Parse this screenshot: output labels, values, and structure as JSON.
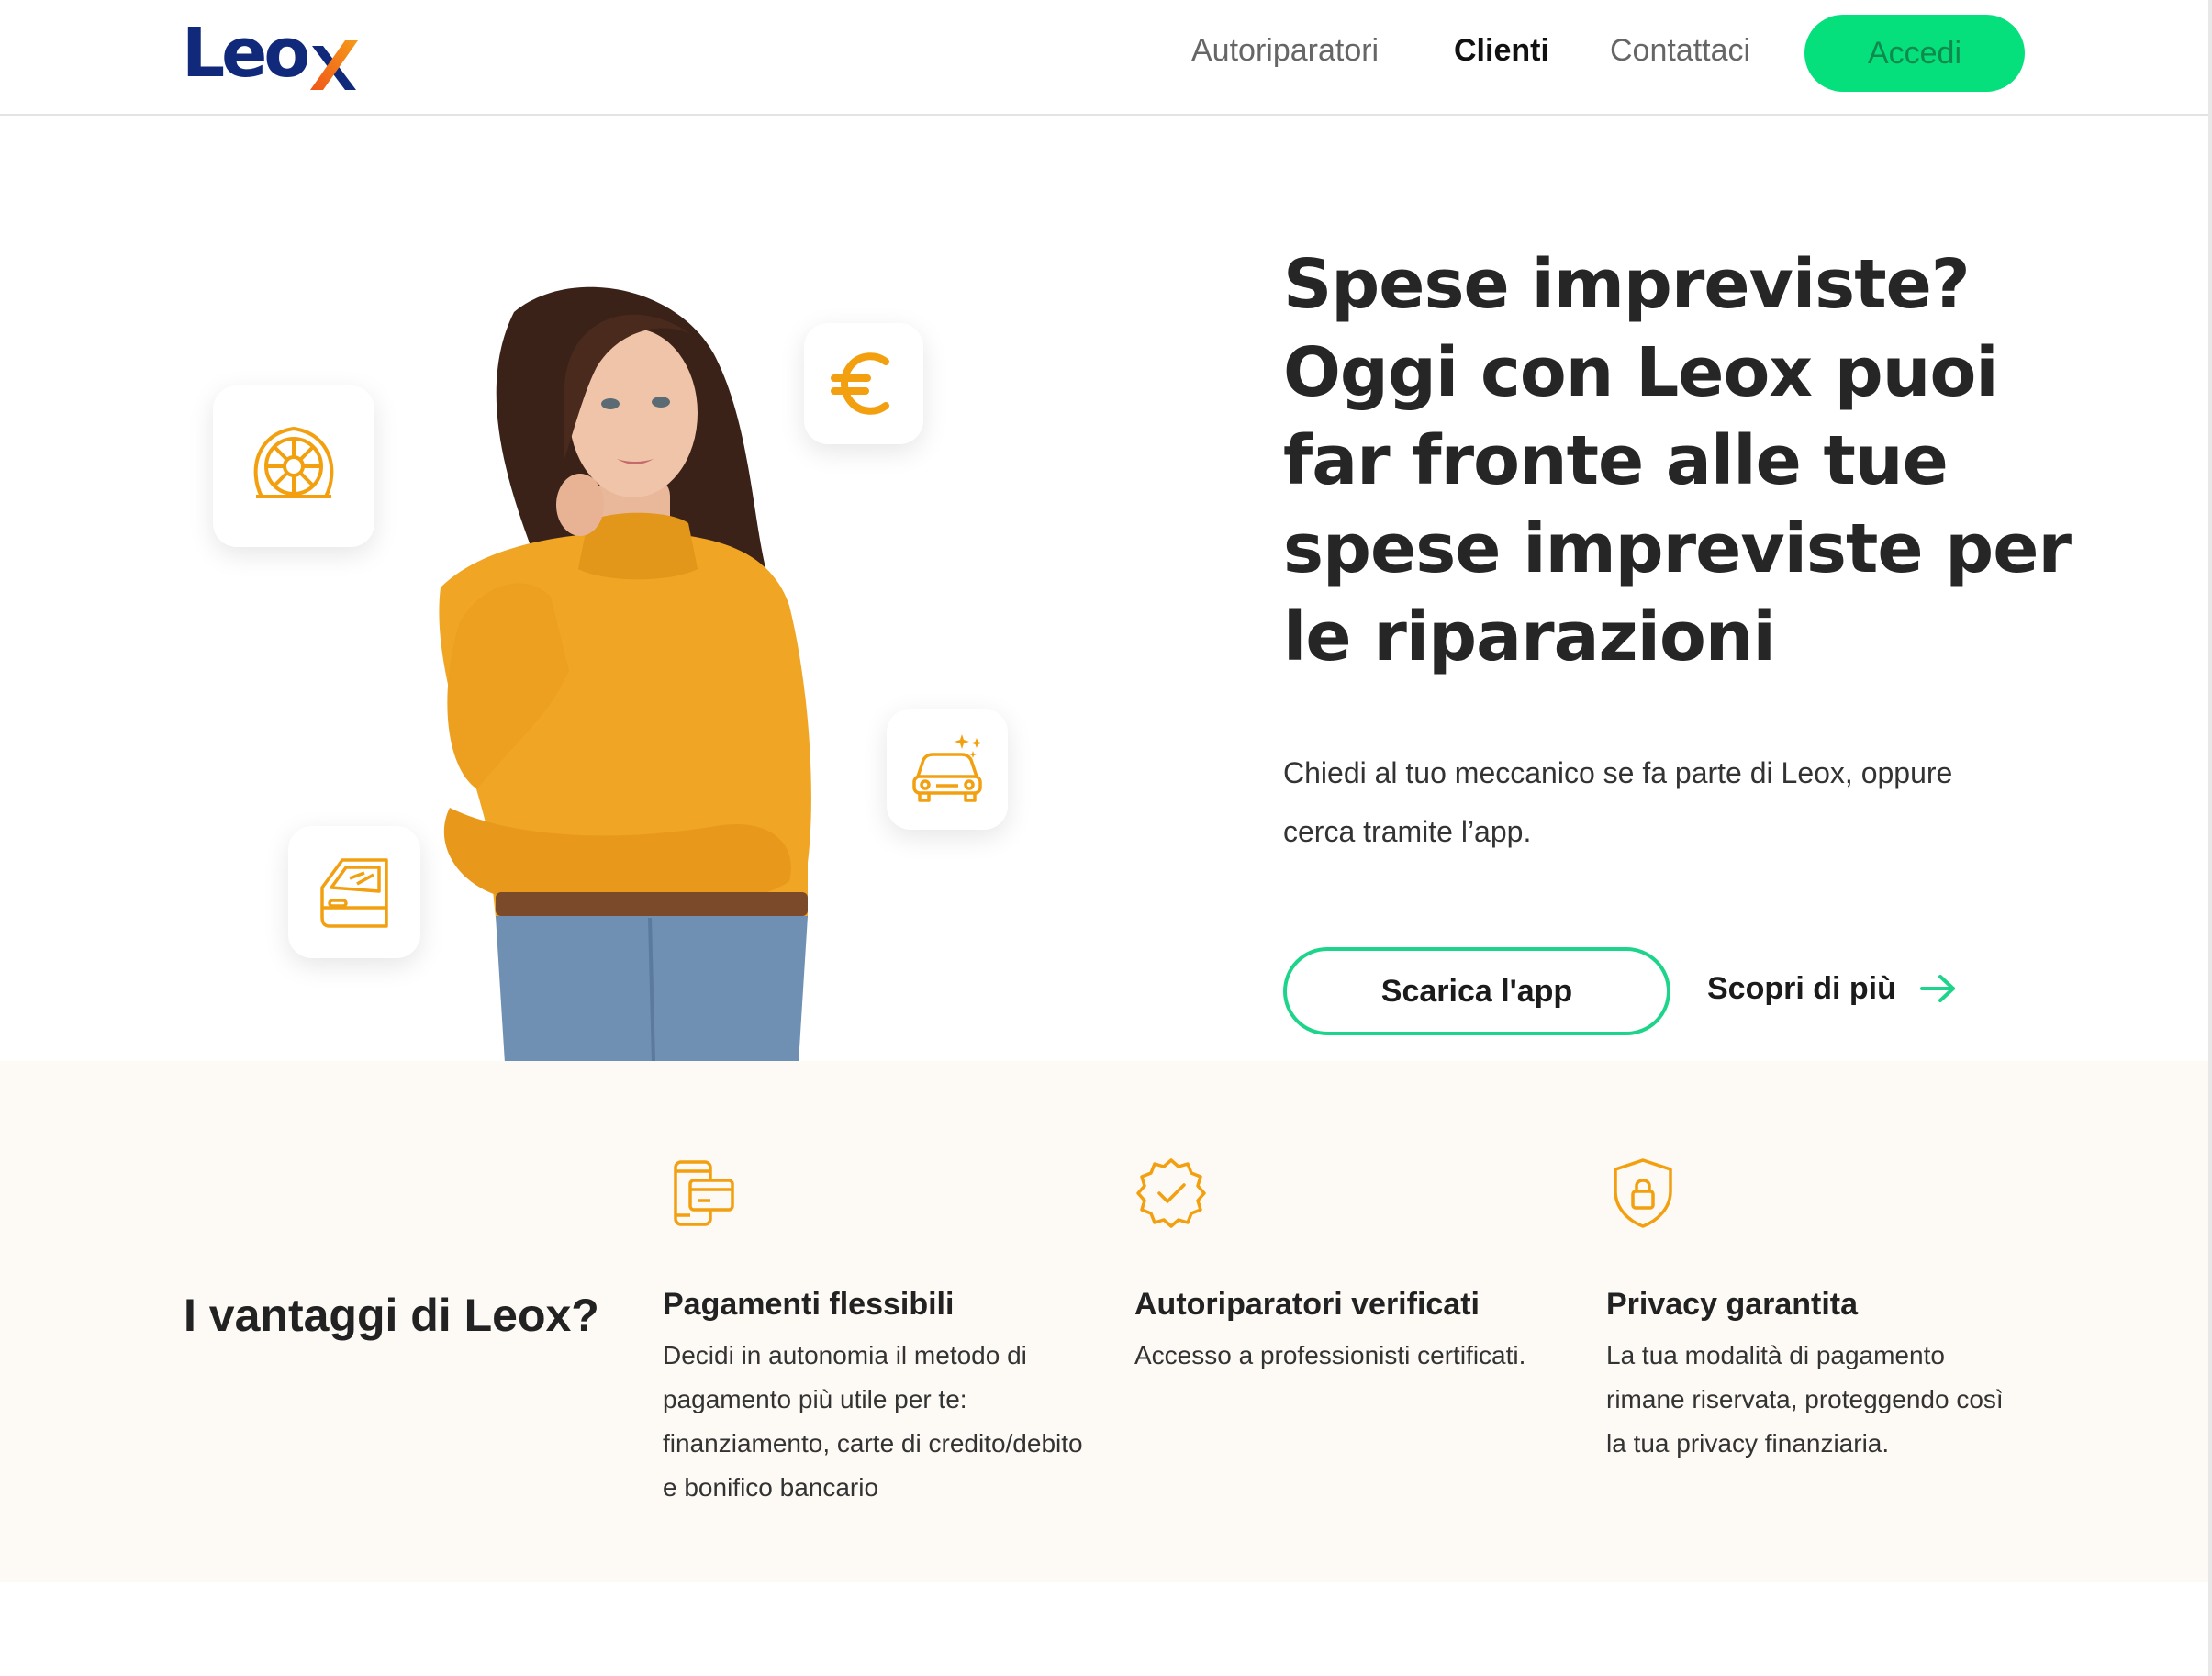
{
  "nav": {
    "logo": "Leox",
    "links": [
      "Autoriparatori",
      "Clienti",
      "Contattaci"
    ],
    "active_link": "Clienti",
    "cta": "Accedi"
  },
  "hero": {
    "title": "Spese impreviste? Oggi con Leox puoi far fronte alle tue spese impreviste per le riparazioni",
    "subtitle": "Chiedi al tuo meccanico se fa parte di Leox, oppure cerca tramite l’app.",
    "primary_button": "Scarica l'app",
    "secondary_link": "Scopri di più",
    "icons": [
      "tire-icon",
      "euro-icon",
      "car-sparkle-icon",
      "car-door-icon"
    ]
  },
  "benefits": {
    "heading": "I vantaggi di Leox?",
    "items": [
      {
        "icon": "payment-card-icon",
        "title": "Pagamenti flessibili",
        "desc": "Decidi in autonomia il metodo di pagamento più utile per te: finanziamento, carte di credito/debito e bonifico bancario"
      },
      {
        "icon": "verified-badge-icon",
        "title": "Autoriparatori verificati",
        "desc": "Accesso a professionisti certificati."
      },
      {
        "icon": "privacy-shield-icon",
        "title": "Privacy garantita",
        "desc": "La tua modalità di pagamento rimane riservata, proteggendo così la tua privacy finanziaria."
      }
    ]
  },
  "colors": {
    "brand_blue": "#10297a",
    "brand_orange": "#f07a1a",
    "accent_green": "#06e07c",
    "icon_orange": "#f2a010",
    "sweater": "#f0a524",
    "benefits_bg": "#fdf9f5"
  }
}
